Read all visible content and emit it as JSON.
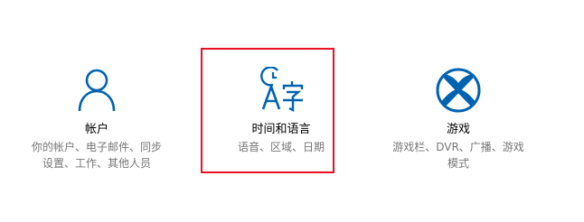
{
  "accent_color": "#0063b1",
  "selection_color": "#e81123",
  "tiles": [
    {
      "id": "accounts",
      "icon": "person-icon",
      "title": "帐户",
      "desc_lines": [
        "你的帐户、电子邮件、同步",
        "设置、工作、其他人员"
      ]
    },
    {
      "id": "time-language",
      "icon": "time-language-icon",
      "title": "时间和语言",
      "desc_lines": [
        "语音、区域、日期"
      ],
      "highlighted": true
    },
    {
      "id": "gaming",
      "icon": "xbox-icon",
      "title": "游戏",
      "desc_lines": [
        "游戏栏、DVR、广播、游戏",
        "模式"
      ]
    }
  ]
}
